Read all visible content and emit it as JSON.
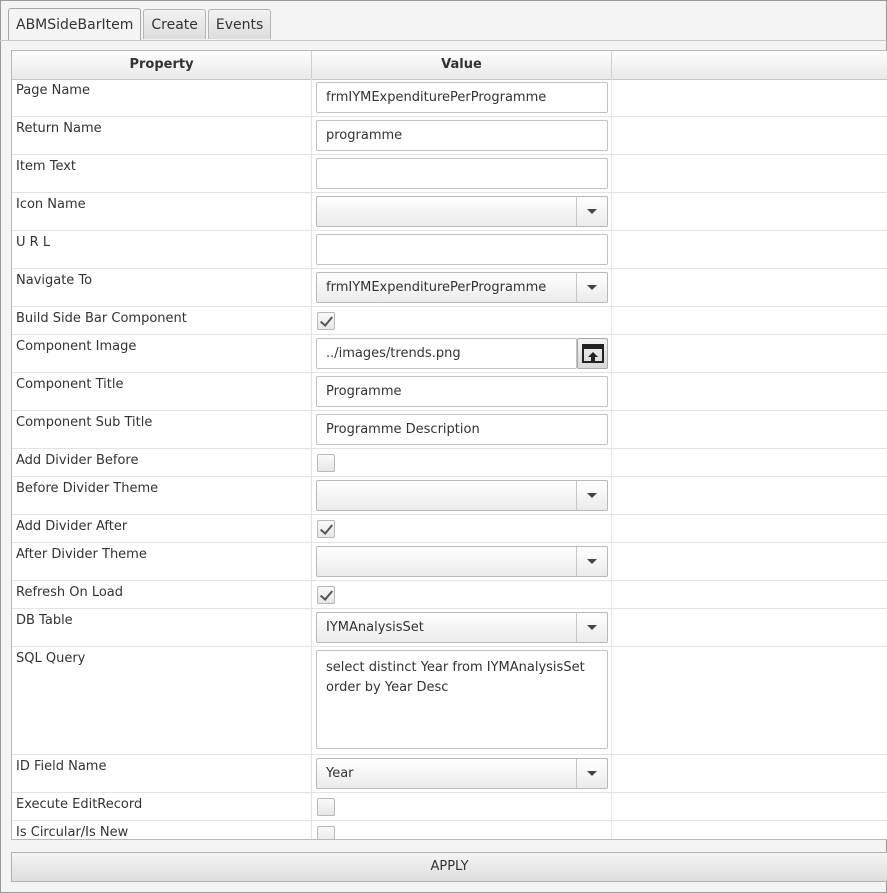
{
  "tabs": [
    {
      "label": "ABMSideBarItem",
      "active": true
    },
    {
      "label": "Create",
      "active": false
    },
    {
      "label": "Events",
      "active": false
    }
  ],
  "grid": {
    "headers": {
      "property": "Property",
      "value": "Value"
    },
    "rows": [
      {
        "property": "Page Name",
        "kind": "text",
        "value": "frmIYMExpenditurePerProgramme"
      },
      {
        "property": "Return Name",
        "kind": "text",
        "value": "programme"
      },
      {
        "property": "Item Text",
        "kind": "text",
        "value": ""
      },
      {
        "property": "Icon Name",
        "kind": "combo",
        "value": ""
      },
      {
        "property": "U R L",
        "kind": "text",
        "value": ""
      },
      {
        "property": "Navigate To",
        "kind": "combo",
        "value": "frmIYMExpenditurePerProgramme"
      },
      {
        "property": "Build Side Bar Component",
        "kind": "check",
        "checked": true
      },
      {
        "property": "Component Image",
        "kind": "file",
        "value": "../images/trends.png"
      },
      {
        "property": "Component Title",
        "kind": "text",
        "value": "Programme"
      },
      {
        "property": "Component Sub Title",
        "kind": "text",
        "value": "Programme Description"
      },
      {
        "property": "Add Divider Before",
        "kind": "check",
        "checked": false
      },
      {
        "property": "Before Divider Theme",
        "kind": "combo",
        "value": ""
      },
      {
        "property": "Add Divider After",
        "kind": "check",
        "checked": true
      },
      {
        "property": "After Divider Theme",
        "kind": "combo",
        "value": ""
      },
      {
        "property": "Refresh On Load",
        "kind": "check",
        "checked": true
      },
      {
        "property": "DB Table",
        "kind": "combo",
        "value": "IYMAnalysisSet"
      },
      {
        "property": "SQL Query",
        "kind": "textarea",
        "value": "select distinct Year from IYMAnalysisSet\norder by Year Desc"
      },
      {
        "property": "ID Field Name",
        "kind": "combo",
        "value": "Year"
      },
      {
        "property": "Execute EditRecord",
        "kind": "check",
        "checked": false
      },
      {
        "property": "Is Circular/Is New",
        "kind": "check",
        "checked": false
      }
    ]
  },
  "apply_label": "APPLY"
}
